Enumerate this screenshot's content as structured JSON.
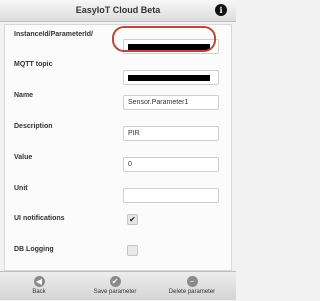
{
  "header": {
    "title": "EasyIoT Cloud Beta",
    "info_icon": "i"
  },
  "form": {
    "instance": {
      "label": "InstanceId/ParameterId/",
      "value": "",
      "redacted": true
    },
    "mqtt": {
      "label": "MQTT topic",
      "value": "",
      "redacted": true
    },
    "name": {
      "label": "Name",
      "value": "Sensor.Parameter1"
    },
    "description": {
      "label": "Description",
      "value": "PIR"
    },
    "value": {
      "label": "Value",
      "value": "0"
    },
    "unit": {
      "label": "Unit",
      "value": ""
    },
    "ui_notifications": {
      "label": "UI notifications",
      "checked": true,
      "mark": "✔"
    },
    "db_logging": {
      "label": "DB Logging",
      "checked": false,
      "mark": ""
    }
  },
  "toolbar": {
    "back": {
      "label": "Back",
      "icon": "left-arrow-icon",
      "glyph": "◀"
    },
    "save": {
      "label": "Save parameter",
      "icon": "check-icon",
      "glyph": "✔"
    },
    "delete": {
      "label": "Delete parameter",
      "icon": "minus-icon",
      "glyph": "−"
    }
  }
}
